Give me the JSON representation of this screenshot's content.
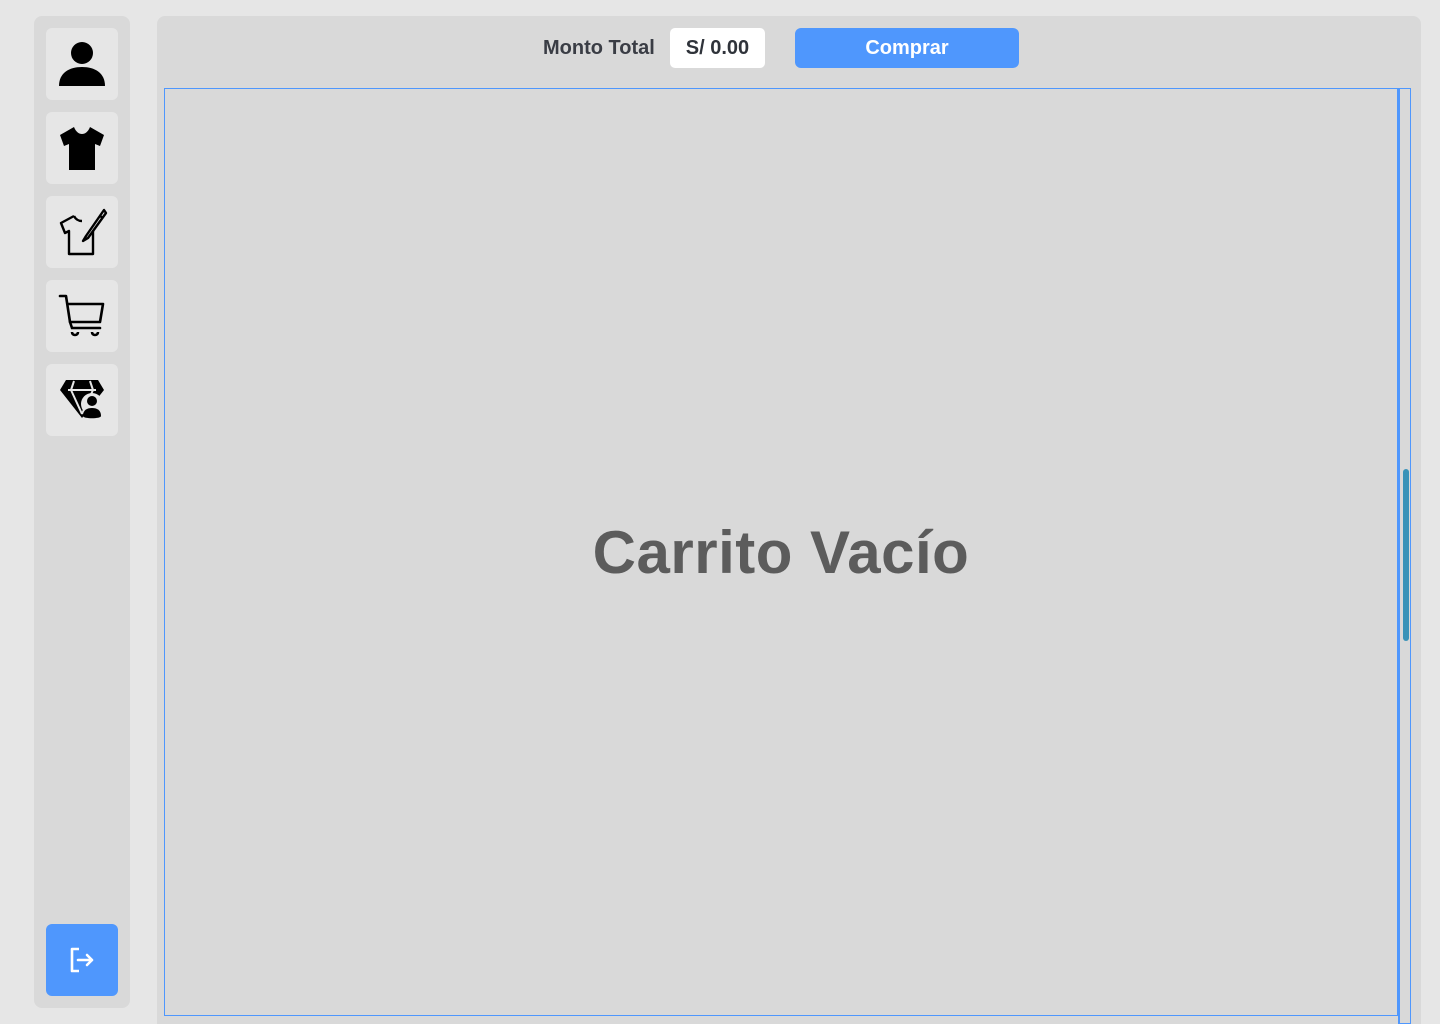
{
  "sidebar": {
    "items": [
      {
        "icon": "user-icon"
      },
      {
        "icon": "tshirt-icon"
      },
      {
        "icon": "tshirt-design-icon"
      },
      {
        "icon": "cart-icon"
      },
      {
        "icon": "store-icon"
      }
    ],
    "logout_icon": "logout-icon"
  },
  "header": {
    "total_label": "Monto Total",
    "total_value": "S/ 0.00",
    "buy_label": "Comprar"
  },
  "cart": {
    "empty_message": "Carrito Vacío"
  },
  "colors": {
    "accent": "#4f97fd",
    "panel": "#d9d9d9",
    "background": "#e6e6e6",
    "scroll_thumb": "#3a93b8"
  }
}
